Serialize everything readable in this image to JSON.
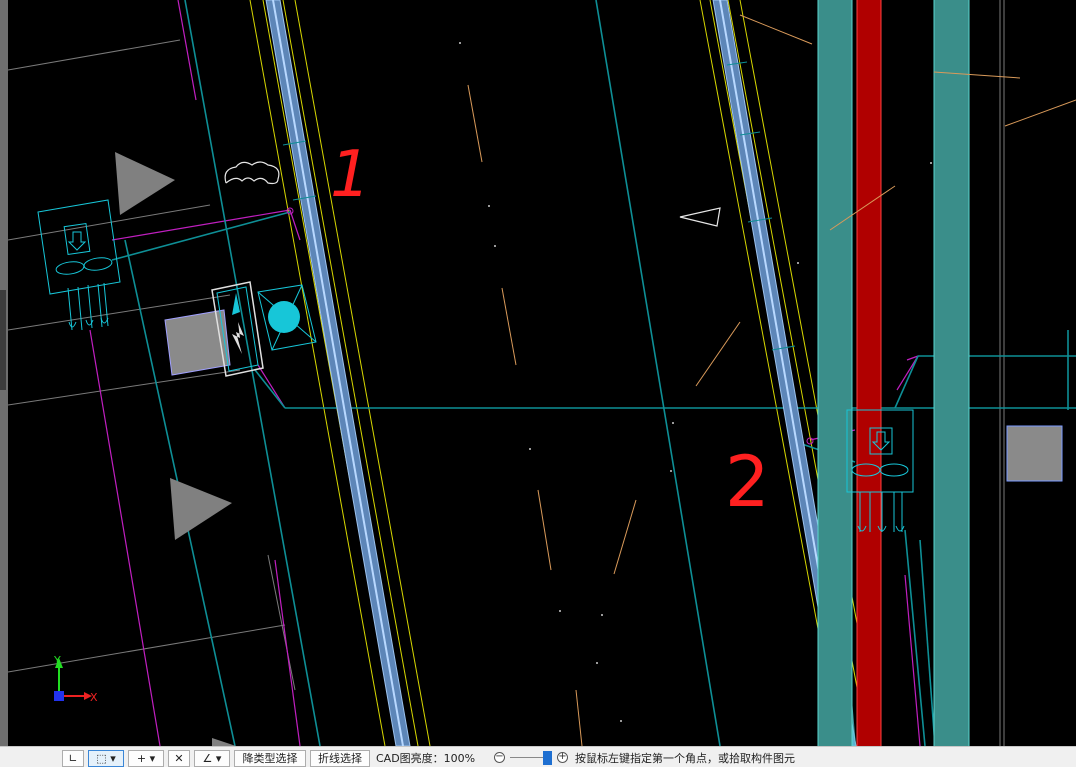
{
  "canvas": {
    "annotations": [
      "1",
      "2"
    ],
    "axis_labels": {
      "x": "X",
      "y": "Y"
    },
    "colors": {
      "background": "#000000",
      "teal_lines": "#0e8f96",
      "teal_bars": "#3a8e8a",
      "red_bar": "#b00000",
      "magenta": "#c01fc0",
      "yellow": "#d8d800",
      "pipe_blue": "#7fa9d8",
      "orange": "#d99a5a",
      "gray_fill": "#8a8a8a",
      "cyan_symbol": "#17c6d8",
      "annotation_red": "#ff2020"
    }
  },
  "toolbar": {
    "buttons": [
      {
        "icon": "select-corner-icon"
      },
      {
        "icon": "window-select-icon",
        "dropdown": "▾"
      },
      {
        "icon": "cross-select-icon",
        "dropdown": "▾"
      },
      {
        "icon": "cross-off-icon"
      },
      {
        "icon": "angle-select-icon",
        "dropdown": "▾"
      }
    ],
    "type_select_label": "降类型选择",
    "polyline_select_label": "折线选择",
    "cad_brightness_label": "CAD图亮度：100%",
    "zoom_minus": "−",
    "zoom_plus": "+",
    "status_message": "按鼠标左键指定第一个角点，或拾取构件图元"
  }
}
